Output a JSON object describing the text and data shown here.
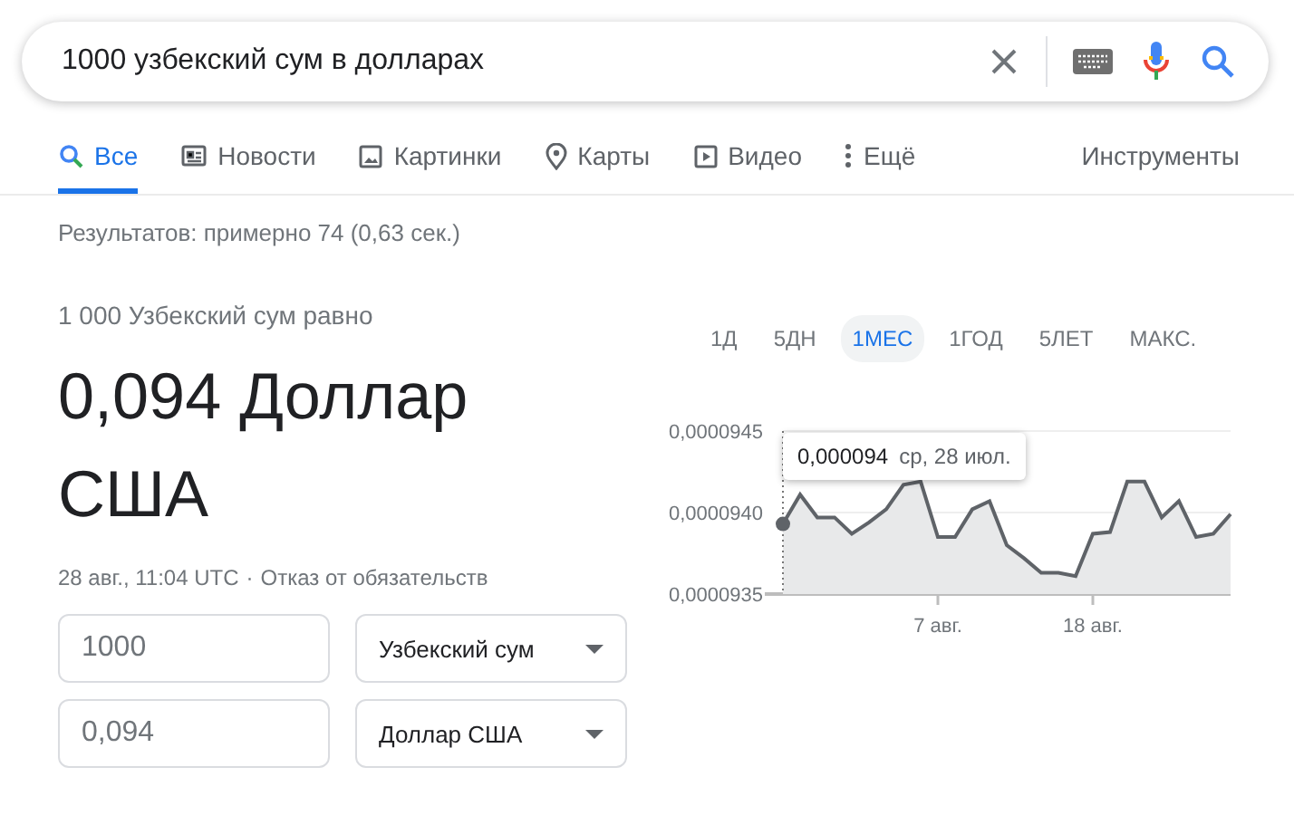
{
  "search": {
    "value": "1000 узбекский сум в долларах"
  },
  "tabs": [
    {
      "label": "Все",
      "selected": true
    },
    {
      "label": "Новости",
      "selected": false
    },
    {
      "label": "Картинки",
      "selected": false
    },
    {
      "label": "Карты",
      "selected": false
    },
    {
      "label": "Видео",
      "selected": false
    },
    {
      "label": "Ещё",
      "selected": false
    }
  ],
  "tools": "Инструменты",
  "results_stats": "Результатов: примерно 74 (0,63 сек.)",
  "converter": {
    "equals_text": "1 000 Узбекский сум равно",
    "result": "0,094 Доллар США",
    "timestamp": "28 авг., 11:04 UTC",
    "separator": "·",
    "disclaimer": "Отказ от обязательств",
    "rows": [
      {
        "amount": "1000",
        "currency": "Узбекский сум"
      },
      {
        "amount": "0,094",
        "currency": "Доллар США"
      }
    ]
  },
  "ranges": [
    {
      "label": "1Д",
      "selected": false
    },
    {
      "label": "5ДН",
      "selected": false
    },
    {
      "label": "1МЕС",
      "selected": true
    },
    {
      "label": "1ГОД",
      "selected": false
    },
    {
      "label": "5ЛЕТ",
      "selected": false
    },
    {
      "label": "МАКС.",
      "selected": false
    }
  ],
  "tooltip": {
    "value": "0,000094",
    "date": "ср, 28 июл."
  },
  "chart_data": {
    "type": "area",
    "categories": [
      null,
      null,
      null,
      null,
      null,
      null,
      null,
      null,
      null,
      "7 авг.",
      null,
      null,
      null,
      null,
      null,
      null,
      null,
      null,
      "18 авг.",
      null,
      null,
      null,
      null,
      null,
      null,
      null,
      null
    ],
    "series": [
      {
        "color": "#5f6368",
        "values": [
          9.393e-05,
          9.411e-05,
          9.397e-05,
          9.397e-05,
          9.387e-05,
          9.394e-05,
          9.402e-05,
          9.417e-05,
          9.419e-05,
          9.385e-05,
          9.385e-05,
          9.402e-05,
          9.407e-05,
          9.38e-05,
          9.372e-05,
          9.363e-05,
          9.363e-05,
          9.361e-05,
          9.387e-05,
          9.388e-05,
          9.419e-05,
          9.419e-05,
          9.397e-05,
          9.407e-05,
          9.385e-05,
          9.387e-05,
          9.399e-05
        ]
      }
    ],
    "ylim": [
      9.35e-05,
      9.45e-05
    ],
    "yticks": [
      {
        "value": 9.35e-05,
        "label": "0,0000935"
      },
      {
        "value": 9.4e-05,
        "label": "0,0000940"
      },
      {
        "value": 9.45e-05,
        "label": "0,0000945"
      }
    ]
  }
}
